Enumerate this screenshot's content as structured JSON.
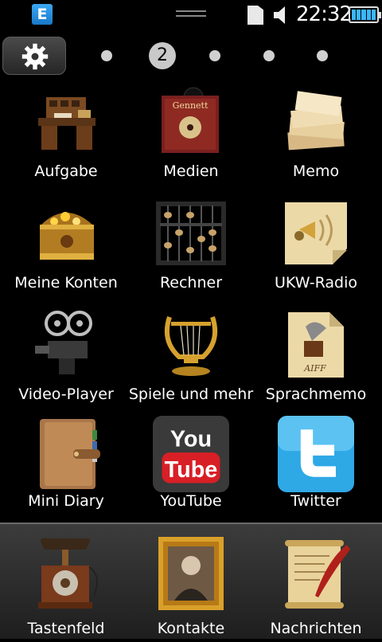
{
  "status": {
    "network_badge": "E",
    "time": "22:32"
  },
  "pager": {
    "current_page": "2"
  },
  "apps": [
    {
      "id": "aufgabe",
      "label": "Aufgabe",
      "icon": "desk-icon"
    },
    {
      "id": "medien",
      "label": "Medien",
      "icon": "record-icon"
    },
    {
      "id": "memo",
      "label": "Memo",
      "icon": "paper-stack-icon"
    },
    {
      "id": "meine-konten",
      "label": "Meine Konten",
      "icon": "treasure-chest-icon"
    },
    {
      "id": "rechner",
      "label": "Rechner",
      "icon": "abacus-icon"
    },
    {
      "id": "ukw-radio",
      "label": "UKW-Radio",
      "icon": "gramophone-note-icon"
    },
    {
      "id": "video-player",
      "label": "Video-Player",
      "icon": "film-projector-icon"
    },
    {
      "id": "spiele",
      "label": "Spiele und mehr",
      "icon": "lyre-icon"
    },
    {
      "id": "sprachmemo",
      "label": "Sprachmemo",
      "icon": "aiff-file-icon",
      "file_label": "AIFF"
    },
    {
      "id": "mini-diary",
      "label": "Mini Diary",
      "icon": "diary-icon"
    },
    {
      "id": "youtube",
      "label": "YouTube",
      "icon": "youtube-icon",
      "logo_top": "You",
      "logo_bottom": "Tube"
    },
    {
      "id": "twitter",
      "label": "Twitter",
      "icon": "twitter-icon"
    }
  ],
  "dock": [
    {
      "id": "tastenfeld",
      "label": "Tastenfeld",
      "icon": "rotary-telephone-icon"
    },
    {
      "id": "kontakte",
      "label": "Kontakte",
      "icon": "portrait-frame-icon"
    },
    {
      "id": "nachrichten",
      "label": "Nachrichten",
      "icon": "quill-scroll-icon"
    }
  ],
  "colors": {
    "battery": "#3ab7ff",
    "e_badge": "#2a8fe0",
    "youtube_red": "#d81f26",
    "twitter_blue": "#2fa8e6"
  }
}
